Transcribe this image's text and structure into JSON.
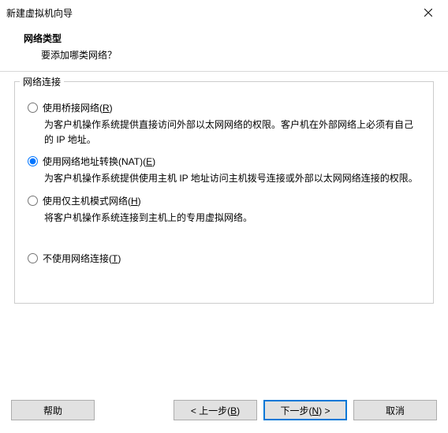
{
  "window": {
    "title": "新建虚拟机向导"
  },
  "header": {
    "heading": "网络类型",
    "sub": "要添加哪类网络？"
  },
  "group": {
    "legend": "网络连接"
  },
  "options": {
    "bridged": {
      "label_pre": "使用桥接网络(",
      "label_key": "R",
      "label_post": ")",
      "desc": "为客户机操作系统提供直接访问外部以太网网络的权限。客户机在外部网络上必须有自己的 IP 地址。",
      "checked": false
    },
    "nat": {
      "label_pre": "使用网络地址转换(NAT)(",
      "label_key": "E",
      "label_post": ")",
      "desc": "为客户机操作系统提供使用主机 IP 地址访问主机拨号连接或外部以太网网络连接的权限。",
      "checked": true
    },
    "hostonly": {
      "label_pre": "使用仅主机模式网络(",
      "label_key": "H",
      "label_post": ")",
      "desc": "将客户机操作系统连接到主机上的专用虚拟网络。",
      "checked": false
    },
    "none": {
      "label_pre": "不使用网络连接(",
      "label_key": "T",
      "label_post": ")",
      "checked": false
    }
  },
  "buttons": {
    "help": "帮助",
    "back_pre": "< 上一步(",
    "back_key": "B",
    "back_post": ")",
    "next_pre": "下一步(",
    "next_key": "N",
    "next_post": ") >",
    "cancel": "取消"
  }
}
